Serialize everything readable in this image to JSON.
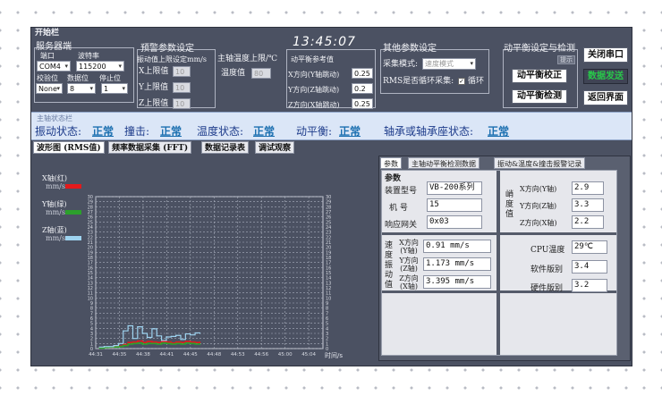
{
  "window": {
    "title": "开始栏",
    "clock": "13:45:07"
  },
  "serial": {
    "group_title": "服务器端",
    "port_label": "端口",
    "baud_label": "波特率",
    "check_label": "校验位",
    "data_label": "数据位",
    "stop_label": "停止位",
    "port_value": "COM4",
    "baud_value": "115200",
    "check_value": "None",
    "data_value": "8",
    "stop_value": "1"
  },
  "alarm": {
    "group_title": "预警参数设定",
    "vib_caption": "振动值上限设定mm/s",
    "x_label": "X上限值",
    "y_label": "Y上限值",
    "z_label": "Z上限值",
    "x_value": "10",
    "y_value": "10",
    "z_value": "10"
  },
  "temp_limit": {
    "caption": "主轴温度上限/℃",
    "label": "温度值",
    "value": "80"
  },
  "balance_ref": {
    "caption": "动平衡参考值",
    "x_label": "X方向(Y轴跳动)",
    "y_label": "Y方向(Z轴跳动)",
    "z_label": "Z方向(X轴跳动)",
    "x_value": "0.25",
    "y_value": "0.2",
    "z_value": "0.25"
  },
  "other": {
    "group_title": "其他参数设定",
    "mode_label": "采集模式:",
    "mode_value": "速度模式",
    "rms_label": "RMS是否循环采集:",
    "loop_label": "循环"
  },
  "balance": {
    "group_title": "动平衡设定与检测",
    "hint": "提示",
    "calibrate": "动平衡校正",
    "detect": "动平衡检测"
  },
  "buttons": {
    "close_port": "关闭串口",
    "send_data": "数据发送",
    "back": "返回界面"
  },
  "status": {
    "title": "主轴状态栏",
    "vib_label": "振动状态:",
    "vib_value": "正常",
    "impact_label": "撞击:",
    "impact_value": "正常",
    "temp_label": "温度状态:",
    "temp_value": "正常",
    "balance_label": "动平衡:",
    "balance_value": "正常",
    "bearing_label": "轴承或轴承座状态:",
    "bearing_value": "正常"
  },
  "tabs": [
    "波形图 (RMS值)",
    "频率数据采集 (FFT)",
    "数据记录表",
    "调试观察"
  ],
  "legend": {
    "x_name": "X轴(红)",
    "y_name": "Y轴(绿)",
    "z_name": "Z轴(蓝)",
    "unit": "mm/s",
    "x_color": "#e31a1c",
    "y_color": "#2ca02c",
    "z_color": "#9ed3f0"
  },
  "chart_data": {
    "type": "line",
    "xlabel": "时间/s",
    "ylabel": "",
    "ylim": [
      0,
      30
    ],
    "x_ticks": [
      "44:31",
      "44:35",
      "44:38",
      "44:41",
      "44:45",
      "44:48",
      "44:53",
      "44:56",
      "45:00",
      "45:04"
    ],
    "y_ticks": [
      0,
      1,
      2,
      3,
      4,
      5,
      6,
      7,
      8,
      9,
      10,
      11,
      12,
      13,
      14,
      15,
      16,
      17,
      18,
      19,
      20,
      21,
      22,
      23,
      24,
      25,
      26,
      27,
      28,
      29,
      30
    ],
    "grid": true,
    "series": [
      {
        "name": "X轴(红)",
        "color": "#e31a1c",
        "values": [
          0.2,
          0.3,
          0.3,
          0.4,
          0.5,
          0.8,
          1.2,
          1.3,
          1.5,
          1.2,
          1.4,
          1.3,
          1.2,
          1.4,
          1.3,
          1.1,
          1.3,
          1.2,
          1.4,
          1.3,
          1.2,
          1.3
        ]
      },
      {
        "name": "Y轴(绿)",
        "color": "#2ca02c",
        "values": [
          0.1,
          0.2,
          0.3,
          0.3,
          0.4,
          0.6,
          0.9,
          1.0,
          1.1,
          0.9,
          1.0,
          1.0,
          0.9,
          1.1,
          1.0,
          0.9,
          1.0,
          0.9,
          1.1,
          1.0,
          0.9,
          1.0
        ]
      },
      {
        "name": "Z轴(蓝)",
        "color": "#9ed3f0",
        "values": [
          0.3,
          0.4,
          0.4,
          0.6,
          1.0,
          3.5,
          4.5,
          2.0,
          4.3,
          3.0,
          2.2,
          3.9,
          2.5,
          1.6,
          2.3,
          2.4,
          2.6,
          1.8,
          2.9,
          2.7,
          3.1,
          3.0
        ]
      }
    ]
  },
  "right_tabs": [
    "参数",
    "主轴动平衡检测数据",
    "振动&温度&撞击报警记录"
  ],
  "params": {
    "section_title": "参数",
    "model_label": "装置型号",
    "model_value": "VB-200系列",
    "machine_label": "机  号",
    "machine_value": "15",
    "gateway_label": "响应网关",
    "gateway_value": "0x03",
    "peak_label": "峭度值",
    "peak_x_label": "X方向(Y轴)",
    "peak_x_value": "2.9",
    "peak_y_label": "Y方向(Z轴)",
    "peak_y_value": "3.3",
    "peak_z_label": "Z方向(X轴)",
    "peak_z_value": "2.2",
    "speed_label": "速度振动值",
    "vx_label": "X方向(Y轴)",
    "vx_value": "0.91 mm/s",
    "vy_label": "Y方向(Z轴)",
    "vy_value": "1.173 mm/s",
    "vz_label": "Z方向(X轴)",
    "vz_value": "3.395 mm/s",
    "cpu_label": "CPU温度",
    "cpu_value": "29℃",
    "sw_label": "软件版别",
    "sw_value": "3.4",
    "hw_label": "硬件版别",
    "hw_value": "3.2"
  }
}
